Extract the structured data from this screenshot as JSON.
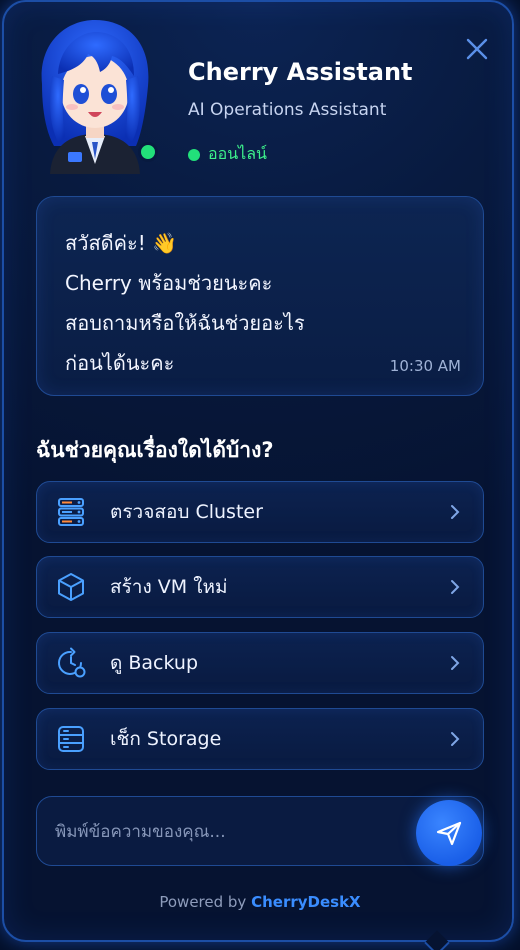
{
  "header": {
    "name": "Cherry Assistant",
    "role": "AI Operations Assistant",
    "status": "ออนไลน์",
    "avatar_icon": "anime-assistant-avatar",
    "close_icon": "close-icon"
  },
  "message": {
    "lines": [
      "สวัสดีค่ะ! 👋",
      "Cherry พร้อมช่วยนะคะ",
      "สอบถามหรือให้ฉันช่วยอะไร",
      "ก่อนได้นะคะ"
    ],
    "time": "10:30 AM"
  },
  "help_title": "ฉันช่วยคุณเรื่องใดได้บ้าง?",
  "actions": [
    {
      "label": "ตรวจสอบ Cluster",
      "icon": "server-cluster-icon"
    },
    {
      "label": "สร้าง VM ใหม่",
      "icon": "cube-icon"
    },
    {
      "label": "ดู Backup",
      "icon": "backup-clock-icon"
    },
    {
      "label": "เช็ก Storage",
      "icon": "storage-icon"
    }
  ],
  "input": {
    "placeholder": "พิมพ์ข้อความของคุณ...",
    "value": ""
  },
  "send_icon": "send-icon",
  "footer": {
    "prefix": "Powered by",
    "brand": "CherryDeskX"
  },
  "colors": {
    "accent": "#1a5fe8",
    "online": "#22e07a",
    "brand": "#3a8dff",
    "border": "#1f4a93"
  }
}
